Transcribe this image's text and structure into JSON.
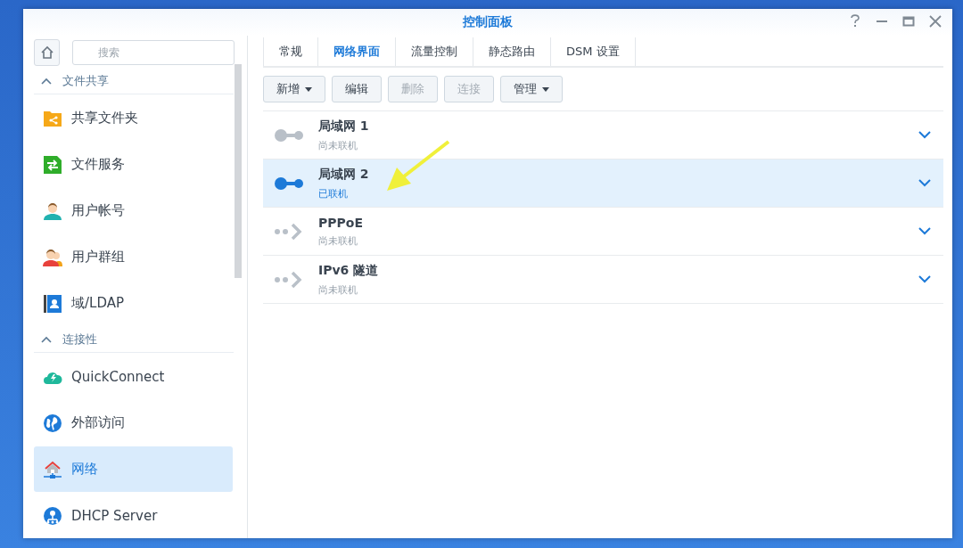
{
  "window": {
    "title": "控制面板"
  },
  "sidebar": {
    "search": {
      "placeholder": "搜索"
    },
    "sections": [
      {
        "label": "文件共享",
        "expanded": true,
        "items": [
          {
            "label": "共享文件夹",
            "kind": "folder",
            "selected": false
          },
          {
            "label": "文件服务",
            "kind": "fileservice",
            "selected": false
          },
          {
            "label": "用户帐号",
            "kind": "user",
            "selected": false
          },
          {
            "label": "用户群组",
            "kind": "group",
            "selected": false
          },
          {
            "label": "域/LDAP",
            "kind": "ldap",
            "selected": false
          }
        ]
      },
      {
        "label": "连接性",
        "expanded": true,
        "items": [
          {
            "label": "QuickConnect",
            "kind": "quickconnect",
            "selected": false
          },
          {
            "label": "外部访问",
            "kind": "globe",
            "selected": false
          },
          {
            "label": "网络",
            "kind": "network",
            "selected": true
          },
          {
            "label": "DHCP Server",
            "kind": "dhcp",
            "selected": false
          }
        ]
      }
    ]
  },
  "tabs": [
    {
      "label": "常规",
      "selected": false
    },
    {
      "label": "网络界面",
      "selected": true
    },
    {
      "label": "流量控制",
      "selected": false
    },
    {
      "label": "静态路由",
      "selected": false
    },
    {
      "label": "DSM 设置",
      "selected": false
    }
  ],
  "toolbar": [
    {
      "label": "新增",
      "disabled": false,
      "menu": true
    },
    {
      "label": "编辑",
      "disabled": false,
      "menu": false
    },
    {
      "label": "删除",
      "disabled": true,
      "menu": false
    },
    {
      "label": "连接",
      "disabled": true,
      "menu": false
    },
    {
      "label": "管理",
      "disabled": false,
      "menu": true
    }
  ],
  "interfaces": [
    {
      "name": "局域网 1",
      "status": "尚未联机",
      "kind": "lan",
      "connected": false,
      "selected": false
    },
    {
      "name": "局域网 2",
      "status": "已联机",
      "kind": "lan",
      "connected": true,
      "selected": true
    },
    {
      "name": "PPPoE",
      "status": "尚未联机",
      "kind": "tunnel",
      "connected": false,
      "selected": false
    },
    {
      "name": "IPv6 隧道",
      "status": "尚未联机",
      "kind": "tunnel",
      "connected": false,
      "selected": false
    }
  ]
}
